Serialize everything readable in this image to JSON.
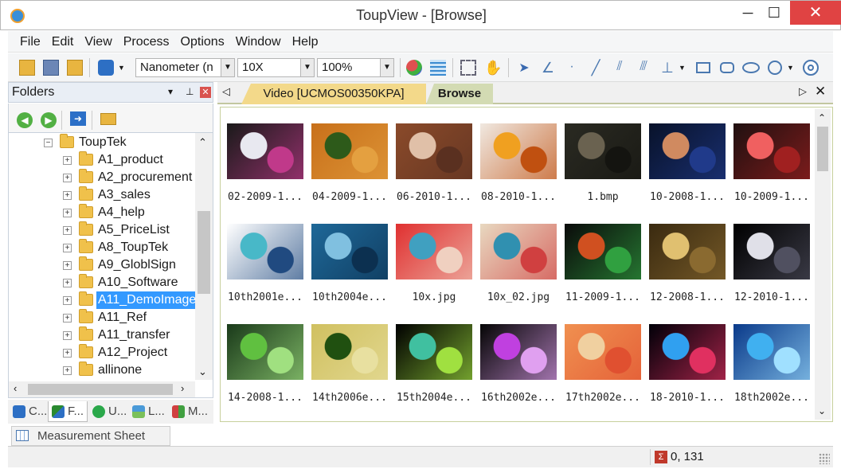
{
  "window": {
    "title": "ToupView - [Browse]",
    "minimize": "─",
    "maximize": "☐",
    "close": "✕"
  },
  "menu": [
    {
      "label": "File"
    },
    {
      "label": "Edit"
    },
    {
      "label": "View"
    },
    {
      "label": "Process"
    },
    {
      "label": "Options"
    },
    {
      "label": "Window"
    },
    {
      "label": "Help"
    }
  ],
  "toolbar": {
    "unit": "Nanometer (n",
    "magnification": "10X",
    "zoom": "100%",
    "icons": [
      "open-folder-icon",
      "save-icon",
      "browse-folder-icon",
      "camera-icon",
      "color-icon",
      "grid-icon",
      "crop-icon",
      "hand-icon",
      "pointer-icon",
      "angle-icon",
      "point-icon",
      "line-icon",
      "parallel-lines-icon",
      "parallel-angle-icon",
      "perpendicular-icon",
      "rectangle-icon",
      "rounded-rect-icon",
      "ellipse-icon",
      "circle-icon",
      "concentric-circle-icon"
    ]
  },
  "folders_panel": {
    "title": "Folders",
    "pin": "▾",
    "dock": "⊥",
    "close": "✕",
    "tree": [
      {
        "label": "ToupTek",
        "expanded": true,
        "level": 0
      },
      {
        "label": "A1_product",
        "level": 1
      },
      {
        "label": "A2_procurement",
        "level": 1
      },
      {
        "label": "A3_sales",
        "level": 1
      },
      {
        "label": "A4_help",
        "level": 1
      },
      {
        "label": "A5_PriceList",
        "level": 1
      },
      {
        "label": "A8_ToupTek",
        "level": 1
      },
      {
        "label": "A9_GloblSign",
        "level": 1
      },
      {
        "label": "A10_Software",
        "level": 1
      },
      {
        "label": "A11_DemoImage",
        "level": 1,
        "selected": true
      },
      {
        "label": "A11_Ref",
        "level": 1
      },
      {
        "label": "A11_transfer",
        "level": 1
      },
      {
        "label": "A12_Project",
        "level": 1
      },
      {
        "label": "allinone",
        "level": 1
      }
    ]
  },
  "bottom_tabs": [
    {
      "label": "C..."
    },
    {
      "label": "F...",
      "active": true
    },
    {
      "label": "U..."
    },
    {
      "label": "L..."
    },
    {
      "label": "M..."
    }
  ],
  "measurement_sheet": "Measurement Sheet",
  "doc_tabs": [
    {
      "label": "Video [UCMOS00350KPA]"
    },
    {
      "label": "Browse",
      "active": true
    }
  ],
  "gallery": [
    {
      "caption": "02-2009-1...",
      "colors": [
        "#1a1a1a",
        "#e8e8f0",
        "#c0398a"
      ]
    },
    {
      "caption": "04-2009-1...",
      "colors": [
        "#c8701a",
        "#2d5a1a",
        "#e4a040"
      ]
    },
    {
      "caption": "06-2010-1...",
      "colors": [
        "#8a4a2a",
        "#e0c0a8",
        "#5a3020"
      ]
    },
    {
      "caption": "08-2010-1...",
      "colors": [
        "#f0e8e0",
        "#f0a020",
        "#c05010"
      ]
    },
    {
      "caption": "1.bmp",
      "colors": [
        "#2a2a22",
        "#6a6250",
        "#141410"
      ]
    },
    {
      "caption": "10-2008-1...",
      "colors": [
        "#08122a",
        "#d08a60",
        "#203a8a"
      ]
    },
    {
      "caption": "10-2009-1...",
      "colors": [
        "#201010",
        "#f06060",
        "#a02020"
      ]
    },
    {
      "caption": "10th2001e...",
      "colors": [
        "#ffffff",
        "#48b8c8",
        "#204a80"
      ]
    },
    {
      "caption": "10th2004e...",
      "colors": [
        "#1e6898",
        "#80c0e0",
        "#0c3050"
      ]
    },
    {
      "caption": "10x.jpg",
      "colors": [
        "#e03030",
        "#40a0c0",
        "#f0d0c0"
      ]
    },
    {
      "caption": "10x_02.jpg",
      "colors": [
        "#e8d8c0",
        "#3090b0",
        "#d04040"
      ]
    },
    {
      "caption": "11-2009-1...",
      "colors": [
        "#0a0a0a",
        "#d05020",
        "#30a040"
      ]
    },
    {
      "caption": "12-2008-1...",
      "colors": [
        "#3a2a10",
        "#e0c070",
        "#8a6a30"
      ]
    },
    {
      "caption": "12-2010-1...",
      "colors": [
        "#000000",
        "#e0e0e8",
        "#505060"
      ]
    },
    {
      "caption": "14-2008-1...",
      "colors": [
        "#1a3a1a",
        "#60c040",
        "#a0e080"
      ]
    },
    {
      "caption": "14th2006e...",
      "colors": [
        "#d0c060",
        "#205010",
        "#e8e0a0"
      ]
    },
    {
      "caption": "15th2004e...",
      "colors": [
        "#000000",
        "#40c0a0",
        "#a0e040"
      ]
    },
    {
      "caption": "16th2002e...",
      "colors": [
        "#050505",
        "#c040e0",
        "#e0a0f0"
      ]
    },
    {
      "caption": "17th2002e...",
      "colors": [
        "#f09050",
        "#f0d0a0",
        "#e05030"
      ]
    },
    {
      "caption": "18-2010-1...",
      "colors": [
        "#000008",
        "#30a0f0",
        "#e03060"
      ]
    },
    {
      "caption": "18th2002e...",
      "colors": [
        "#0a3a8a",
        "#40b0f0",
        "#a0e0ff"
      ]
    }
  ],
  "status": {
    "coords": "0, 131",
    "sigma": "Σ"
  }
}
